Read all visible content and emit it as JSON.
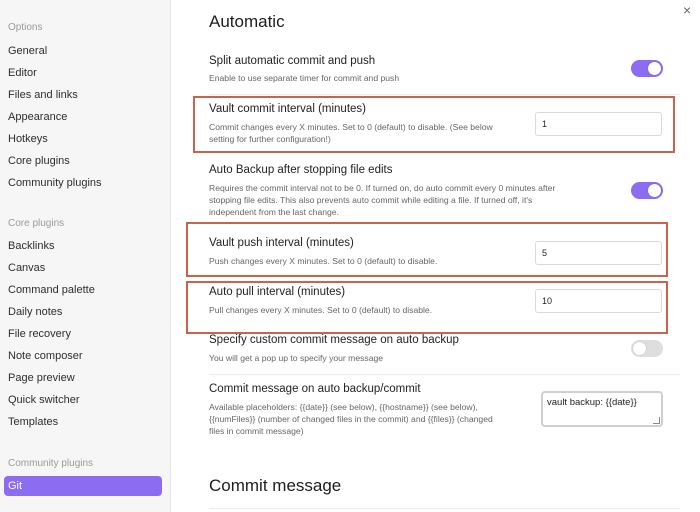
{
  "sidebar": {
    "options_title": "Options",
    "options_items": [
      {
        "label": "General"
      },
      {
        "label": "Editor"
      },
      {
        "label": "Files and links"
      },
      {
        "label": "Appearance"
      },
      {
        "label": "Hotkeys"
      },
      {
        "label": "Core plugins"
      },
      {
        "label": "Community plugins"
      }
    ],
    "core_title": "Core plugins",
    "core_items": [
      {
        "label": "Backlinks"
      },
      {
        "label": "Canvas"
      },
      {
        "label": "Command palette"
      },
      {
        "label": "Daily notes"
      },
      {
        "label": "File recovery"
      },
      {
        "label": "Note composer"
      },
      {
        "label": "Page preview"
      },
      {
        "label": "Quick switcher"
      },
      {
        "label": "Templates"
      }
    ],
    "community_title": "Community plugins",
    "community_items": [
      {
        "label": "Git",
        "active": true
      }
    ]
  },
  "close_icon": "×",
  "main": {
    "section_title": "Automatic",
    "settings": {
      "split": {
        "name": "Split automatic commit and push",
        "desc": "Enable to use separate timer for commit and push",
        "toggle": "on"
      },
      "commit_interval": {
        "name": "Vault commit interval (minutes)",
        "desc_1": "Commit changes every X minutes. Set to 0 (default) to disable. (See below",
        "desc_2": "setting for further configuration!)",
        "value": "1"
      },
      "auto_backup": {
        "name": "Auto Backup after stopping file edits",
        "desc_1": "Requires the commit interval not to be 0. If turned on, do auto commit every 0 minutes after",
        "desc_2": "stopping file edits. This also prevents auto commit while editing a file. If turned off, it's",
        "desc_3": "independent from the last change.",
        "toggle": "on"
      },
      "push_interval": {
        "name": "Vault push interval (minutes)",
        "desc": "Push changes every X minutes. Set to 0 (default) to disable.",
        "value": "5"
      },
      "pull_interval": {
        "name": "Auto pull interval (minutes)",
        "desc": "Pull changes every X minutes. Set to 0 (default) to disable.",
        "value": "10"
      },
      "custom_message": {
        "name": "Specify custom commit message on auto backup",
        "desc": "You will get a pop up to specify your message",
        "toggle": "off"
      },
      "commit_message": {
        "name": "Commit message on auto backup/commit",
        "desc_1": "Available placeholders: {{date}} (see below), {{hostname}} (see below),",
        "desc_2": "{{numFiles}} (number of changed files in the commit) and {{files}} (changed",
        "desc_3": "files in commit message)",
        "value": "vault backup: {{date}}"
      }
    },
    "next_section_title": "Commit message"
  },
  "colors": {
    "accent": "#8c6cf0",
    "highlight": "#c9624f"
  }
}
